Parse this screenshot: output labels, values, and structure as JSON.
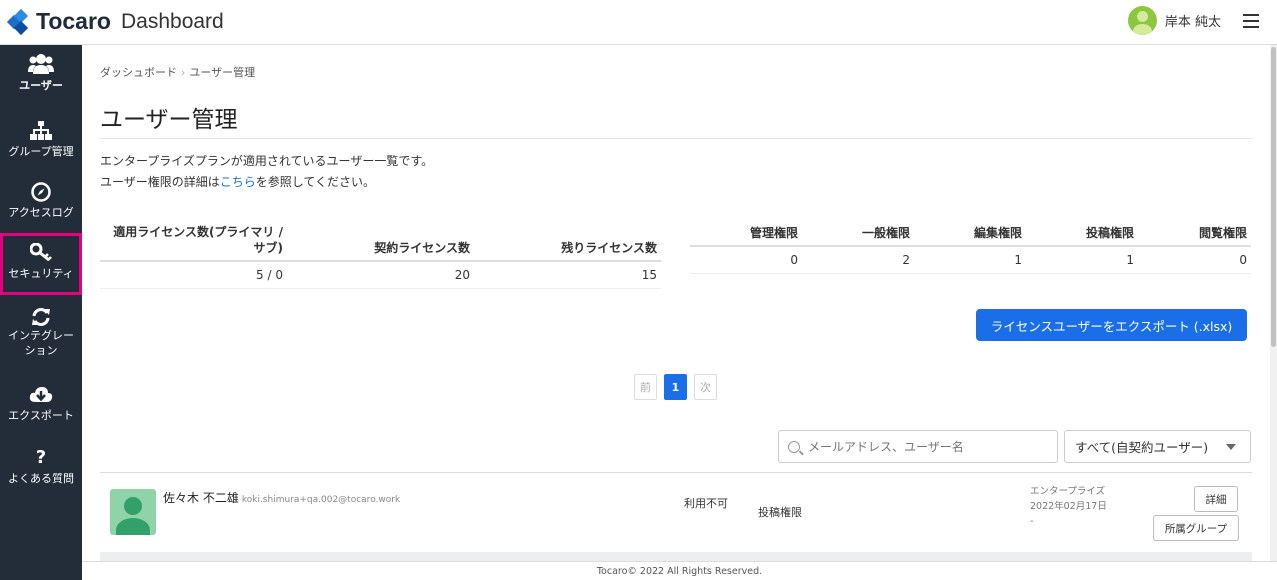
{
  "header": {
    "logo_text": "Tocaro",
    "dashboard_label": "Dashboard",
    "username": "岸本 純太"
  },
  "sidebar": {
    "items": [
      {
        "label": "ユーザー",
        "icon": "users-icon"
      },
      {
        "label": "グループ管理",
        "icon": "org-chart-icon"
      },
      {
        "label": "アクセスログ",
        "icon": "compass-icon"
      },
      {
        "label": "セキュリティ",
        "icon": "key-icon"
      },
      {
        "label_line1": "インテグレー",
        "label_line2": "ション",
        "icon": "sync-icon"
      },
      {
        "label": "エクスポート",
        "icon": "cloud-download-icon"
      },
      {
        "label": "よくある質問",
        "icon": "question-icon"
      }
    ]
  },
  "breadcrumb": {
    "home": "ダッシュボード",
    "current": "ユーザー管理"
  },
  "page": {
    "title": "ユーザー管理",
    "desc_line1": "エンタープライズプランが適用されているユーザー一覧です。",
    "desc_line2_pre": "ユーザー権限の詳細は",
    "desc_line2_link": "こちら",
    "desc_line2_post": "を参照してください。"
  },
  "license_table": {
    "headers": [
      "適用ライセンス数(プライマリ / サブ)",
      "契約ライセンス数",
      "残りライセンス数"
    ],
    "values": [
      "5 / 0",
      "20",
      "15"
    ]
  },
  "role_table": {
    "headers": [
      "管理権限",
      "一般権限",
      "編集権限",
      "投稿権限",
      "閲覧権限"
    ],
    "values": [
      "0",
      "2",
      "1",
      "1",
      "0"
    ]
  },
  "export_button": "ライセンスユーザーをエクスポート (.xlsx)",
  "pager": {
    "prev": "前",
    "current": "1",
    "next": "次"
  },
  "search": {
    "placeholder": "メールアドレス、ユーザー名"
  },
  "filter": {
    "selected": "すべて(自契約ユーザー)"
  },
  "users": [
    {
      "name": "佐々木 不二雄",
      "email": "koki.shimura+qa.002@tocaro.work",
      "status": "利用不可",
      "role": "投稿権限",
      "plan_line1": "エンタープライズ",
      "plan_line2": "2022年02月17日 -",
      "detail_button": "詳細",
      "group_button": "所属グループ"
    }
  ],
  "footer": "Tocaro© 2022 All Rights Reserved.",
  "colors": {
    "sidebar_bg": "#232d39",
    "primary": "#1a6fe8",
    "highlight": "#e6007e"
  }
}
